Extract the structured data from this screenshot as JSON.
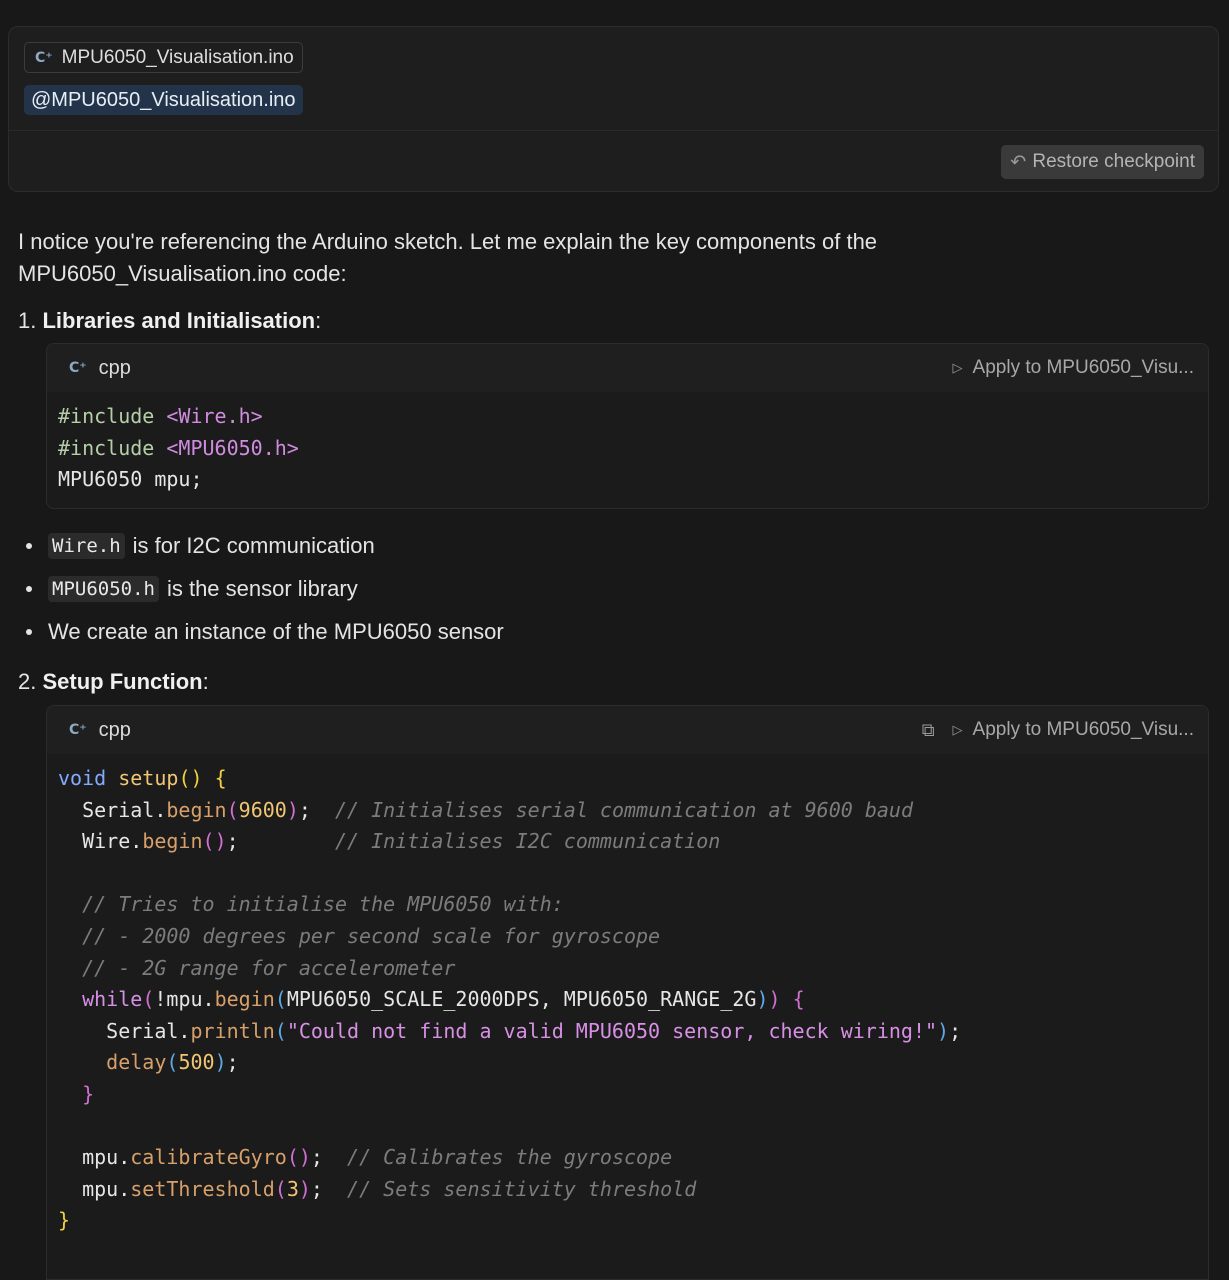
{
  "query": {
    "file_chip_label": "MPU6050_Visualisation.ino",
    "mention_text": "@MPU6050_Visualisation.ino",
    "restore_label": "Restore checkpoint"
  },
  "response": {
    "intro": "I notice you're referencing the Arduino sketch. Let me explain the key components of the MPU6050_Visualisation.ino code:",
    "sections": [
      {
        "number": "1.",
        "title": "Libraries and Initialisation",
        "suffix": ":"
      },
      {
        "number": "2.",
        "title": "Setup Function",
        "suffix": ":"
      }
    ],
    "bullets": [
      {
        "code": "Wire.h",
        "text": "is for I2C communication"
      },
      {
        "code": "MPU6050.h",
        "text": "is the sensor library"
      },
      {
        "code": "",
        "text": "We create an instance of the MPU6050 sensor"
      }
    ],
    "code_blocks": [
      {
        "language": "cpp",
        "apply_label": "Apply to MPU6050_Visu..."
      },
      {
        "language": "cpp",
        "apply_label": "Apply to MPU6050_Visu..."
      }
    ]
  },
  "code": {
    "b1": {
      "inc1": "#include",
      "file1": "<Wire.h>",
      "inc2": "#include",
      "file2": "<MPU6050.h>",
      "decl": "MPU6050 mpu;"
    },
    "b2": {
      "void": "void",
      "setup": "setup",
      "paren_open_close": "()",
      "brace_open": "{",
      "serial": "Serial.",
      "begin": "begin",
      "po": "(",
      "baud": "9600",
      "pc": ")",
      "semi": ";",
      "c1": "// Initialises serial communication at 9600 baud",
      "wire": "Wire.",
      "begin2": "begin",
      "po2": "()",
      "semi2": ";",
      "c2": "// Initialises I2C communication",
      "c3": "// Tries to initialise the MPU6050 with:",
      "c4": "// - 2000 degrees per second scale for gyroscope",
      "c5": "// - 2G range for accelerometer",
      "while": "while",
      "wpo": "(",
      "not_mpu": "!mpu.",
      "begin3": "begin",
      "bpo": "(",
      "args": "MPU6050_SCALE_2000DPS, MPU6050_RANGE_2G",
      "bpc": ")",
      "wpc": ")",
      "wbrace": "{",
      "serial2": "Serial.",
      "println": "println",
      "ppo": "(",
      "msg": "\"Could not find a valid MPU6050 sensor, check wiring!\"",
      "ppc": ")",
      "semi3": ";",
      "delay": "delay",
      "dpo": "(",
      "ms": "500",
      "dpc": ")",
      "semi4": ";",
      "wclose": "}",
      "mpu1": "mpu.",
      "calib": "calibrateGyro",
      "cpo": "()",
      "semi5": ";",
      "c6": "// Calibrates the gyroscope",
      "mpu2": "mpu.",
      "thresh": "setThreshold",
      "tpo": "(",
      "tval": "3",
      "tpc": ")",
      "semi6": ";",
      "c7": "// Sets sensitivity threshold",
      "brace_close": "}"
    }
  }
}
